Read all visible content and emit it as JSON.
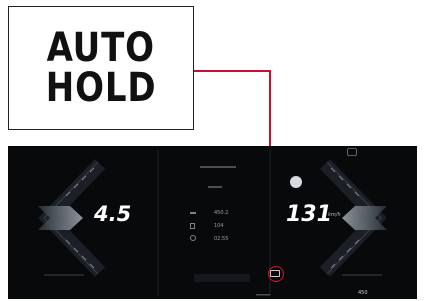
{
  "callout": {
    "line1": "AUTO",
    "line2": "HOLD",
    "leader_color": "#c8102e"
  },
  "cluster": {
    "left_value": "4.5",
    "left_unit": "",
    "right_value": "131",
    "right_unit": "km/h",
    "top_status": "",
    "gear_label": "",
    "trip": [
      {
        "icon": "distance-icon",
        "value": "450.2"
      },
      {
        "icon": "fuel-icon",
        "value": "104"
      },
      {
        "icon": "clock-icon",
        "value": "02:55"
      }
    ],
    "bottom_message": "",
    "range_value": "450",
    "drive_badge": "",
    "auto_hold_icon": "auto-hold-icon",
    "highlight_color": "#e3122c"
  }
}
